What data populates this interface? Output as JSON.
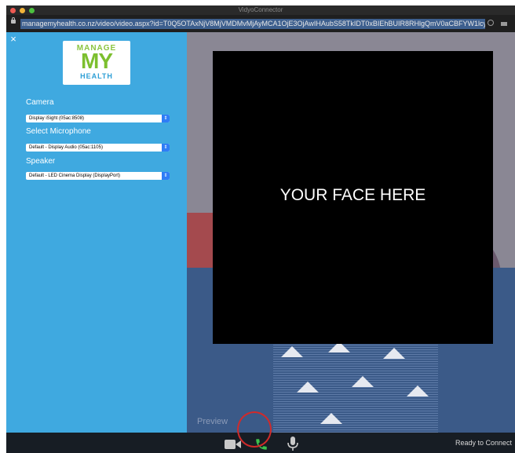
{
  "window": {
    "title": "VidyoConnector"
  },
  "browser": {
    "url": "managemyhealth.co.nz/video/video.aspx?id=T0Q5OTAxNjV8MjVMDMvMjAyMCA1OjE3OjAwIHAubS58TkIDT0xBIEhBUIR8RHlgQmV0aCBFYW1lcyA"
  },
  "sidebar": {
    "close_label": "×",
    "logo": {
      "line1": "MANAGE",
      "line2": "MY",
      "line3": "HEALTH"
    },
    "camera": {
      "label": "Camera",
      "value": "Display iSight (05ac:8508)"
    },
    "microphone": {
      "label": "Select Microphone",
      "value": "Default - Display Audio (05ac:1105)"
    },
    "speaker": {
      "label": "Speaker",
      "value": "Default - LED Cinema Display (DisplayPort)"
    }
  },
  "video": {
    "placeholder_text": "YOUR FACE HERE",
    "preview_label": "Preview"
  },
  "bottom_bar": {
    "status": "Ready to Connect",
    "icons": [
      "camera-icon",
      "phone-icon",
      "microphone-icon"
    ]
  },
  "colors": {
    "sidebar": "#3fa9e0",
    "select_accent": "#2f7df6",
    "phone": "#3cc04d",
    "highlight_ring": "#d12a2a",
    "bottom_bar": "#171d24"
  }
}
